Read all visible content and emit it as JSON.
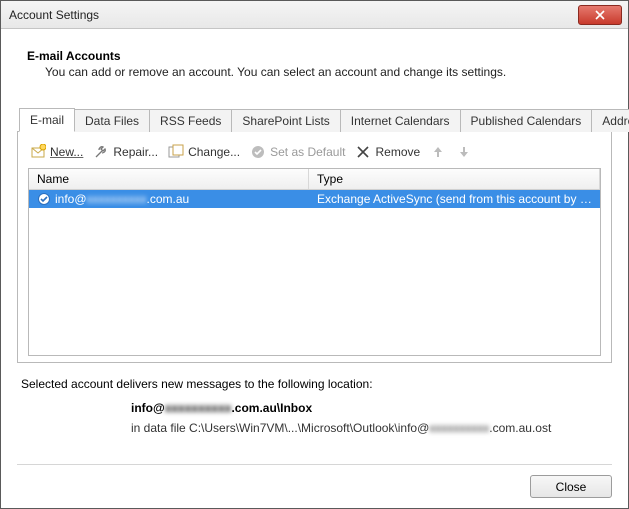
{
  "window": {
    "title": "Account Settings"
  },
  "header": {
    "title": "E-mail Accounts",
    "subtitle": "You can add or remove an account. You can select an account and change its settings."
  },
  "tabs": [
    {
      "label": "E-mail",
      "active": true
    },
    {
      "label": "Data Files"
    },
    {
      "label": "RSS Feeds"
    },
    {
      "label": "SharePoint Lists"
    },
    {
      "label": "Internet Calendars"
    },
    {
      "label": "Published Calendars"
    },
    {
      "label": "Address Books"
    }
  ],
  "toolbar": {
    "new": "New...",
    "repair": "Repair...",
    "change": "Change...",
    "setdefault": "Set as Default",
    "remove": "Remove"
  },
  "list": {
    "columns": {
      "name": "Name",
      "type": "Type"
    },
    "rows": [
      {
        "name_prefix": "info@",
        "name_blur": "xxxxxxxxxx",
        "name_suffix": ".com.au",
        "type": "Exchange ActiveSync (send from this account by de..."
      }
    ]
  },
  "info": {
    "intro": "Selected account delivers new messages to the following location:",
    "loc_prefix": "info@",
    "loc_blur": "xxxxxxxxxx",
    "loc_suffix": ".com.au\\Inbox",
    "path_prefix": "in data file C:\\Users\\Win7VM\\...\\Microsoft\\Outlook\\info@",
    "path_blur": "xxxxxxxxxx",
    "path_suffix": ".com.au.ost"
  },
  "footer": {
    "close": "Close"
  }
}
